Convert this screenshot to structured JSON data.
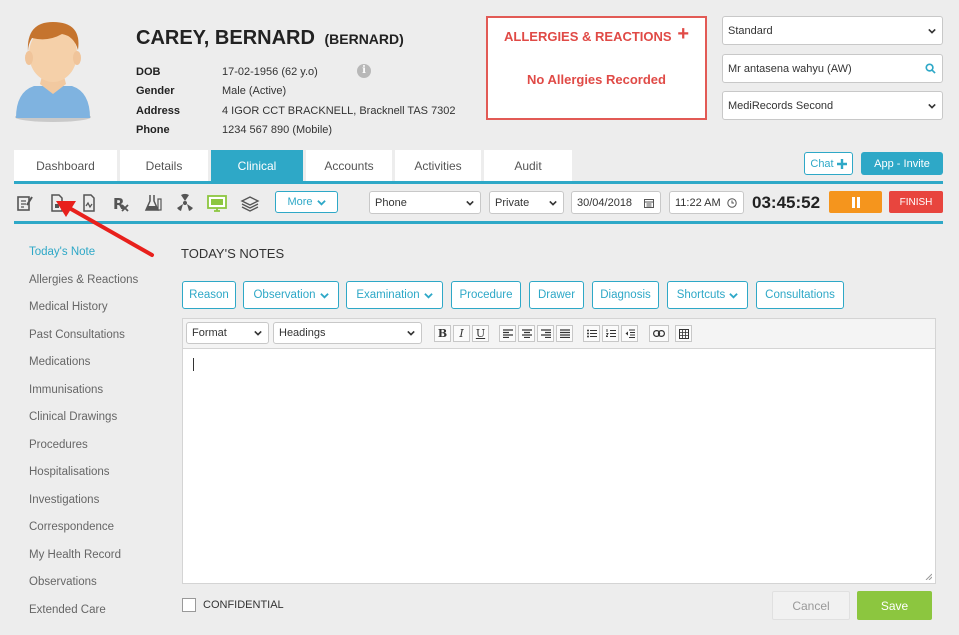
{
  "patient": {
    "name": "CAREY, BERNARD",
    "preferred": "(BERNARD)",
    "fields": [
      {
        "label": "DOB",
        "value": "17-02-1956 (62 y.o)"
      },
      {
        "label": "Gender",
        "value": "Male (Active)"
      },
      {
        "label": "Address",
        "value": "4 IGOR CCT BRACKNELL, Bracknell TAS 7302"
      },
      {
        "label": "Phone",
        "value": "1234 567 890 (Mobile)"
      }
    ]
  },
  "allergies": {
    "title": "ALLERGIES & REACTIONS",
    "empty_text": "No Allergies Recorded"
  },
  "selectors": {
    "template": "Standard",
    "practitioner": "Mr antasena wahyu (AW)",
    "location": "MediRecords Second"
  },
  "tabs": [
    {
      "label": "Dashboard",
      "active": false
    },
    {
      "label": "Details",
      "active": false
    },
    {
      "label": "Clinical",
      "active": true
    },
    {
      "label": "Accounts",
      "active": false
    },
    {
      "label": "Activities",
      "active": false
    },
    {
      "label": "Audit",
      "active": false
    }
  ],
  "header_buttons": {
    "chat": "Chat",
    "app_invite": "App - Invite"
  },
  "toolbar": {
    "more": "More",
    "contact_type": "Phone",
    "billing": "Private",
    "date": "30/04/2018",
    "time": "11:22 AM",
    "timer": "03:45:52",
    "finish": "FINISH"
  },
  "nav": [
    {
      "label": "Today's Note",
      "active": true
    },
    {
      "label": "Allergies & Reactions",
      "active": false
    },
    {
      "label": "Medical History",
      "active": false
    },
    {
      "label": "Past Consultations",
      "active": false
    },
    {
      "label": "Medications",
      "active": false
    },
    {
      "label": "Immunisations",
      "active": false
    },
    {
      "label": "Clinical Drawings",
      "active": false
    },
    {
      "label": "Procedures",
      "active": false
    },
    {
      "label": "Hospitalisations",
      "active": false
    },
    {
      "label": "Investigations",
      "active": false
    },
    {
      "label": "Correspondence",
      "active": false
    },
    {
      "label": "My Health Record",
      "active": false
    },
    {
      "label": "Observations",
      "active": false
    },
    {
      "label": "Extended Care",
      "active": false
    }
  ],
  "notes": {
    "title": "TODAY'S NOTES",
    "categories": [
      "Reason",
      "Observation",
      "Examination",
      "Procedure",
      "Drawer",
      "Diagnosis",
      "Shortcuts",
      "Consultations"
    ],
    "format_select": "Format",
    "headings_select": "Headings",
    "confidential_label": "CONFIDENTIAL",
    "cancel": "Cancel",
    "save": "Save"
  },
  "colors": {
    "accent": "#2ea8c7",
    "alert": "#e04a46",
    "pause": "#f5951d",
    "finish": "#e8453e",
    "save": "#8cc63f"
  }
}
